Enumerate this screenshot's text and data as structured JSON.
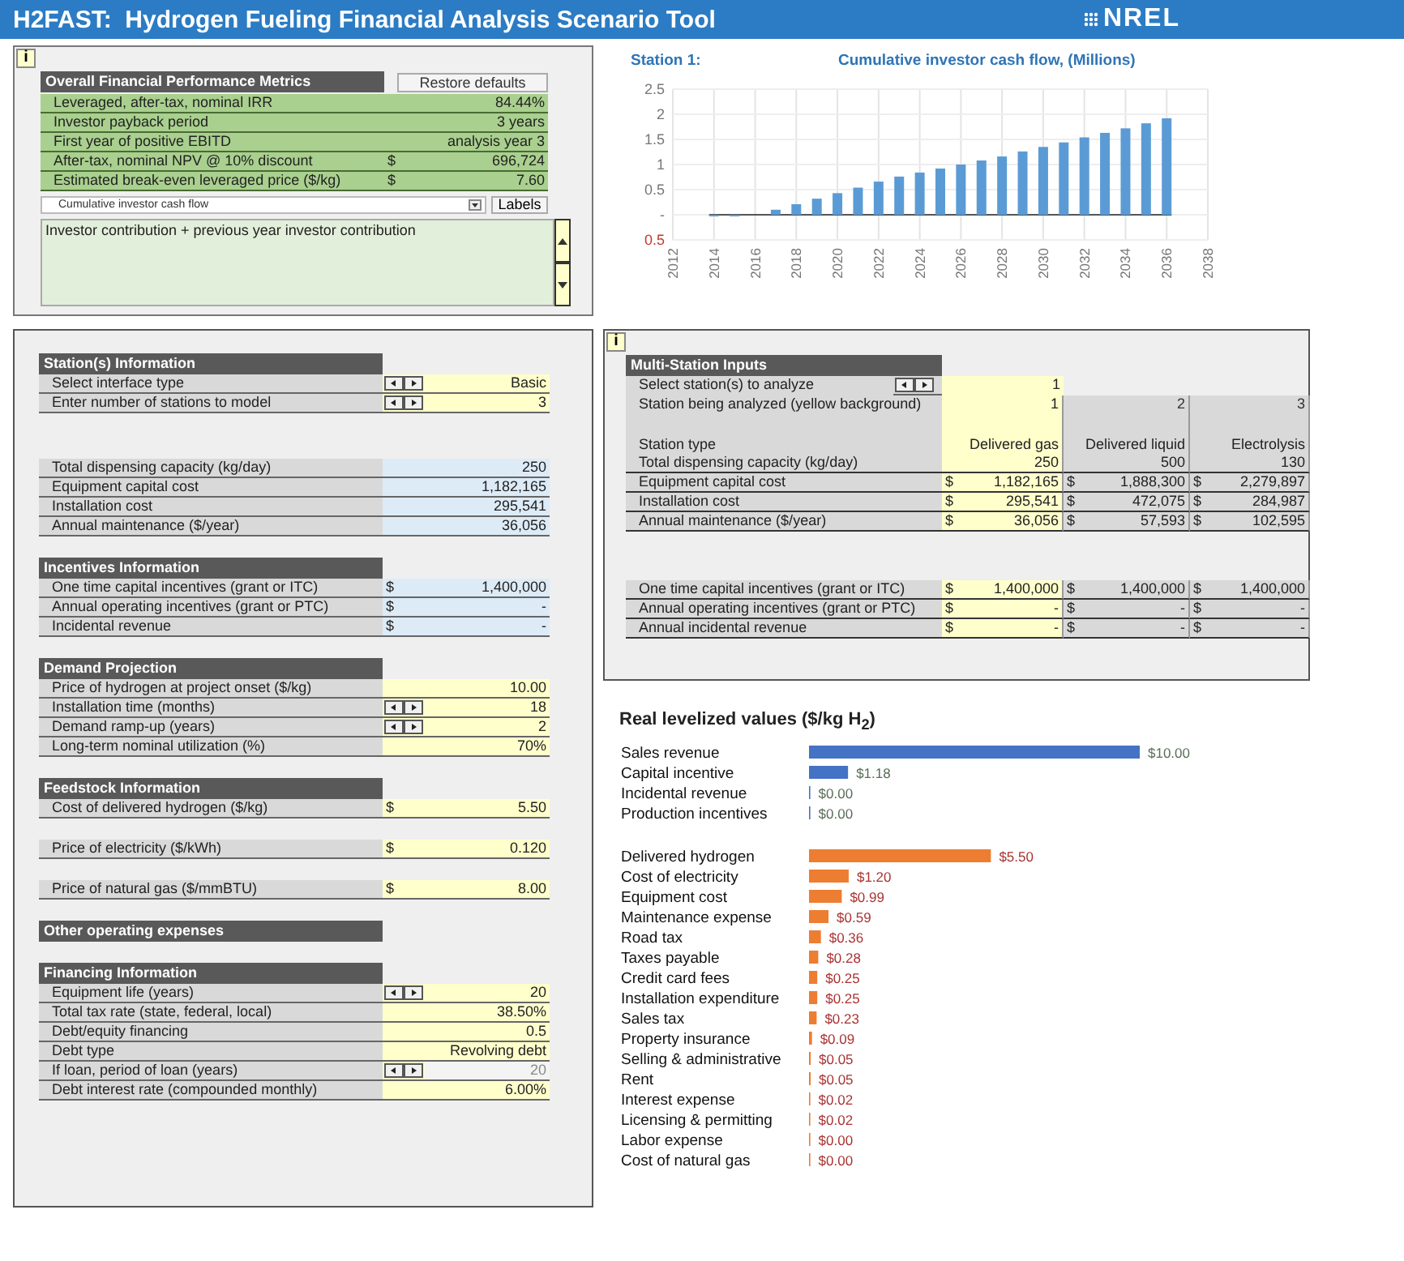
{
  "header": {
    "title": "H2FAST:  Hydrogen Fueling Financial Analysis Scenario Tool",
    "logo": "NREL"
  },
  "metrics_panel": {
    "info_button": "i",
    "title": "Overall Financial Performance Metrics",
    "restore_button": "Restore defaults",
    "rows": [
      {
        "label": "Leveraged, after-tax, nominal IRR",
        "value": "84.44%"
      },
      {
        "label": "Investor payback period",
        "value": "3 years"
      },
      {
        "label": "First year of positive EBITD",
        "value": "analysis year 3"
      },
      {
        "label": "After-tax, nominal NPV @ 10% discount",
        "currency": "$",
        "value": "696,724"
      },
      {
        "label": "Estimated break-even leveraged price ($/kg)",
        "currency": "$",
        "value": "7.60"
      }
    ],
    "chart_selector": {
      "value": "Cumulative investor cash flow"
    },
    "labels_button": "Labels",
    "description": "Investor contribution + previous year investor contribution"
  },
  "cash_flow_chart": {
    "station": "Station 1:",
    "chart_data": {
      "type": "bar",
      "title": "Cumulative investor cash flow, (Millions)",
      "x": [
        2014,
        2015,
        2016,
        2017,
        2018,
        2019,
        2020,
        2021,
        2022,
        2023,
        2024,
        2025,
        2026,
        2027,
        2028,
        2029,
        2030,
        2031,
        2032,
        2033,
        2034,
        2035,
        2036
      ],
      "grid": true,
      "series": [
        {
          "color": "#5b9bd5",
          "values": [
            -0.02,
            -0.02,
            0,
            0.1,
            0.21,
            0.32,
            0.43,
            0.54,
            0.66,
            0.76,
            0.84,
            0.92,
            1.0,
            1.08,
            1.16,
            1.26,
            1.35,
            1.44,
            1.54,
            1.63,
            1.72,
            1.82,
            1.92
          ]
        }
      ],
      "xlim": [
        2012,
        2038
      ],
      "ylim": [
        -0.5,
        2.5
      ],
      "xticks": [
        2012,
        2014,
        2016,
        2018,
        2020,
        2022,
        2024,
        2026,
        2028,
        2030,
        2032,
        2034,
        2036,
        2038
      ],
      "yticks": [
        {
          "value": -0.5,
          "label": "0.5"
        },
        {
          "value": 0,
          "label": "-"
        },
        0.5,
        1,
        1.5,
        2,
        2.5
      ]
    }
  },
  "inputs_panel": {
    "sections": [
      {
        "title": "Station(s) Information",
        "rows": [
          {
            "label": "Select interface type",
            "kind": "input",
            "spinner": true,
            "value": "Basic"
          },
          {
            "label": "Enter number of stations to model",
            "kind": "input",
            "spinner": true,
            "value": "3"
          }
        ]
      },
      {
        "rows": [
          {
            "label": "Total dispensing capacity (kg/day)",
            "kind": "output",
            "value": "250"
          },
          {
            "label": "Equipment capital cost",
            "kind": "output",
            "value": "1,182,165"
          },
          {
            "label": "Installation cost",
            "kind": "output",
            "value": "295,541"
          },
          {
            "label": "Annual maintenance ($/year)",
            "kind": "output",
            "value": "36,056"
          }
        ]
      },
      {
        "title": "Incentives Information",
        "rows": [
          {
            "label": "One time capital incentives (grant or ITC)",
            "kind": "output",
            "currency": "$",
            "value": "1,400,000"
          },
          {
            "label": "Annual operating incentives (grant or PTC)",
            "kind": "output",
            "currency": "$",
            "value": "-"
          },
          {
            "label": "Incidental revenue",
            "kind": "output",
            "currency": "$",
            "value": "-"
          }
        ]
      },
      {
        "title": "Demand Projection",
        "rows": [
          {
            "label": "Price of hydrogen at project onset ($/kg)",
            "kind": "input",
            "value": "10.00"
          },
          {
            "label": "Installation time (months)",
            "kind": "input",
            "spinner": true,
            "value": "18"
          },
          {
            "label": "Demand ramp-up  (years)",
            "kind": "input",
            "spinner": true,
            "value": "2"
          },
          {
            "label": "Long-term nominal utilization (%)",
            "kind": "input",
            "value": "70%"
          }
        ]
      },
      {
        "title": "Feedstock Information",
        "rows": [
          {
            "label": "Cost of delivered hydrogen ($/kg)",
            "kind": "input",
            "currency": "$",
            "value": "5.50"
          }
        ]
      },
      {
        "rows": [
          {
            "label": "Price of electricity ($/kWh)",
            "kind": "input",
            "currency": "$",
            "value": "0.120"
          }
        ]
      },
      {
        "rows": [
          {
            "label": "Price of natural gas  ($/mmBTU)",
            "kind": "input",
            "currency": "$",
            "value": "8.00"
          }
        ]
      },
      {
        "title": "Other operating expenses"
      },
      {
        "title": "Financing Information",
        "rows": [
          {
            "label": "Equipment life (years)",
            "kind": "input",
            "spinner": true,
            "value": "20",
            "disabled": false
          },
          {
            "label": "Total tax rate (state, federal, local)",
            "kind": "input",
            "value": "38.50%",
            "disabled": false
          },
          {
            "label": "Debt/equity financing",
            "kind": "input",
            "value": "0.5",
            "disabled": false
          },
          {
            "label": "Debt type",
            "kind": "input",
            "value": "Revolving debt",
            "disabled": false
          },
          {
            "label": "If loan, period of loan (years)",
            "kind": "input",
            "spinner": true,
            "value": "20",
            "disabled": true
          },
          {
            "label": "Debt interest rate (compounded monthly)",
            "kind": "input",
            "value": "6.00%",
            "disabled": false
          }
        ]
      }
    ]
  },
  "multi_station_panel": {
    "info_button": "i",
    "title": "Multi-Station Inputs",
    "selector": {
      "label": "Select station(s) to analyze",
      "value": "1"
    },
    "station_row_label": "Station being analyzed (yellow background)",
    "type_row_label": "Station type",
    "stations": [
      {
        "number": "1",
        "type": "Delivered gas",
        "selected": true
      },
      {
        "number": "2",
        "type": "Delivered liquid",
        "selected": false
      },
      {
        "number": "3",
        "type": "Electrolysis",
        "selected": false
      }
    ],
    "cost_rows": [
      {
        "label": "Total dispensing capacity (kg/day)",
        "values": [
          "250",
          "500",
          "130"
        ]
      },
      {
        "label": "Equipment capital cost",
        "currency": "$",
        "values": [
          "1,182,165",
          "1,888,300",
          "2,279,897"
        ]
      },
      {
        "label": "Installation cost",
        "currency": "$",
        "values": [
          "295,541",
          "472,075",
          "284,987"
        ]
      },
      {
        "label": "Annual maintenance ($/year)",
        "currency": "$",
        "values": [
          "36,056",
          "57,593",
          "102,595"
        ]
      }
    ],
    "incentive_rows": [
      {
        "label": "One time capital incentives (grant or ITC)",
        "currency": "$",
        "values": [
          "1,400,000",
          "1,400,000",
          "1,400,000"
        ]
      },
      {
        "label": "Annual operating incentives (grant or PTC)",
        "currency": "$",
        "values": [
          "-",
          "-",
          "-"
        ]
      },
      {
        "label": "Annual incidental revenue",
        "currency": "$",
        "values": [
          "-",
          "-",
          "-"
        ]
      }
    ]
  },
  "levelized_values": {
    "title": "Real levelized values ($/kg H$_{2}$)",
    "revenue_chart": {
      "chart_data": {
        "type": "bar",
        "orientation": "horizontal",
        "categories": [
          "Sales revenue",
          "Capital incentive",
          "Incidental revenue",
          "Production incentives"
        ],
        "series": [
          {
            "color": "#4472c4",
            "values": [
              10,
              1.18,
              0,
              0
            ],
            "value_labels": [
              "$10.00",
              "$1.18",
              "$0.00",
              "$0.00"
            ]
          }
        ]
      }
    },
    "cost_chart": {
      "chart_data": {
        "type": "bar",
        "orientation": "horizontal",
        "categories": [
          "Delivered hydrogen",
          "Cost of electricity",
          "Equipment cost",
          "Maintenance expense",
          "Road tax",
          "Taxes payable",
          "Credit card fees",
          "Installation expenditure",
          "Sales tax",
          "Property insurance",
          "Selling & administrative",
          "Rent",
          "Interest expense",
          "Licensing & permitting",
          "Labor expense",
          "Cost of natural gas"
        ],
        "series": [
          {
            "color": "#ed7d31",
            "values": [
              5.5,
              1.2,
              0.99,
              0.59,
              0.36,
              0.28,
              0.25,
              0.25,
              0.23,
              0.09,
              0.05,
              0.05,
              0.02,
              0.02,
              0,
              0
            ],
            "value_labels": [
              "$5.50",
              "$1.20",
              "$0.99",
              "$0.59",
              "$0.36",
              "$0.28",
              "$0.25",
              "$0.25",
              "$0.23",
              "$0.09",
              "$0.05",
              "$0.05",
              "$0.02",
              "$0.02",
              "$0.00",
              "$0.00"
            ]
          }
        ]
      }
    }
  }
}
